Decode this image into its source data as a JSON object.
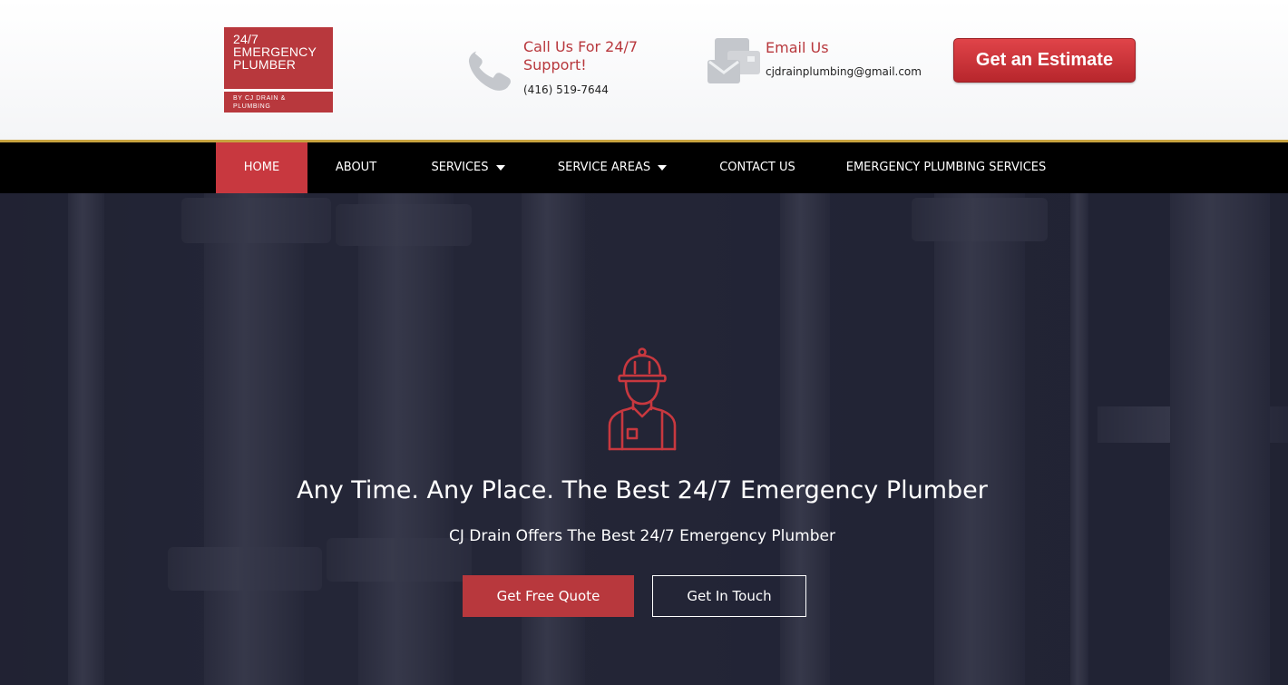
{
  "brand": {
    "logo_text": "24/7 EMERGENCY PLUMBER",
    "logo_subtext": "BY CJ DRAIN & PLUMBING"
  },
  "header": {
    "phone": {
      "title": "Call Us For 24/7 Support!",
      "number": "(416) 519-7644",
      "icon": "phone-icon"
    },
    "email": {
      "title": "Email Us",
      "address": "cjdrainplumbing@gmail.com",
      "icon": "email-icon"
    },
    "estimate_label": "Get an Estimate"
  },
  "nav": {
    "items": [
      {
        "label": "HOME",
        "active": true
      },
      {
        "label": "ABOUT"
      },
      {
        "label": "SERVICES",
        "dropdown": true
      },
      {
        "label": "SERVICE AREAS",
        "dropdown": true
      },
      {
        "label": "CONTACT US"
      },
      {
        "label": "EMERGENCY PLUMBING SERVICES"
      }
    ]
  },
  "hero": {
    "icon": "plumber-worker-icon",
    "title": "Any Time. Any Place. The Best 24/7 Emergency Plumber",
    "subtitle": "CJ Drain Offers The Best 24/7 Emergency Plumber",
    "primary_button": "Get Free Quote",
    "secondary_button": "Get In Touch"
  },
  "colors": {
    "accent": "#b8383d",
    "nav_background": "#000000",
    "nav_border": "#c8a33f",
    "hero_overlay": "#2a2c3a"
  }
}
